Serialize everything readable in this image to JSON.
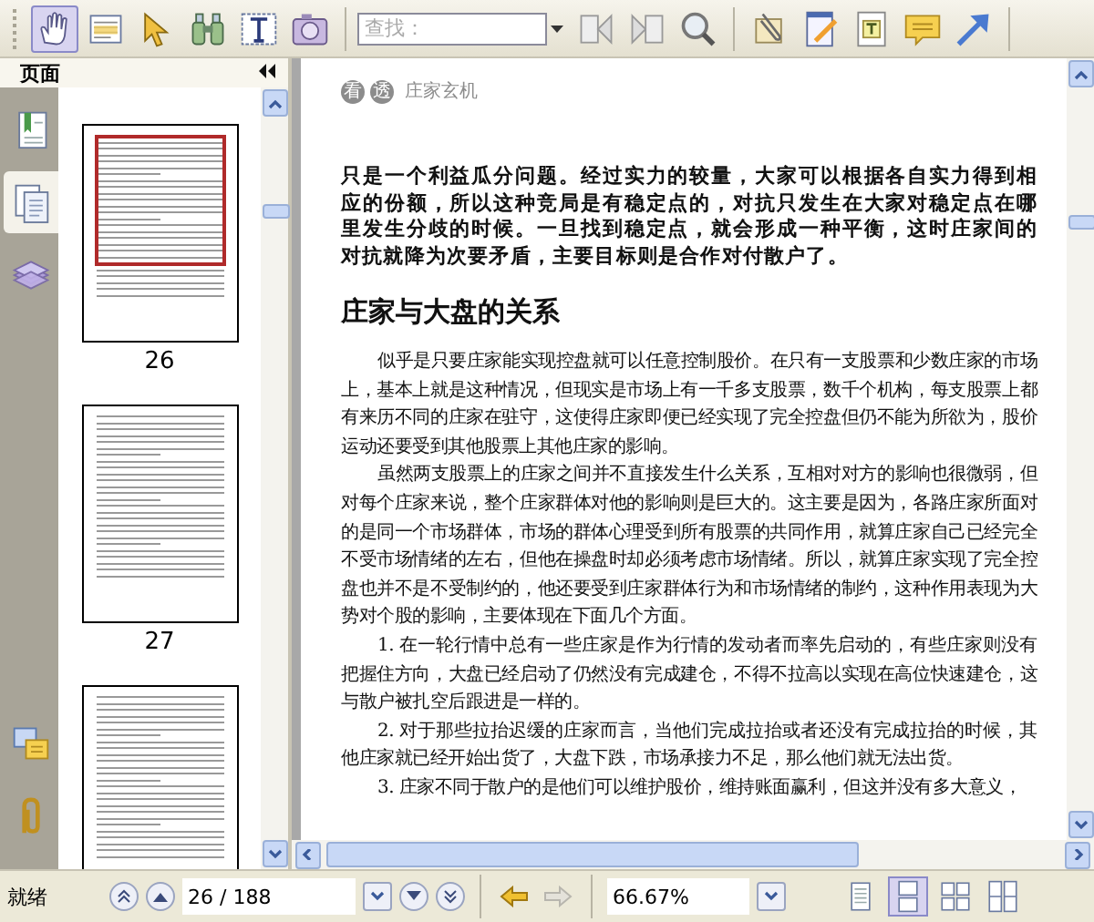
{
  "toolbar": {
    "tools": [
      {
        "kind": "hand",
        "selected": true
      },
      {
        "kind": "select",
        "selected": false
      },
      {
        "kind": "pointer",
        "selected": false
      },
      {
        "kind": "binoculars",
        "selected": false
      },
      {
        "kind": "text",
        "selected": false
      },
      {
        "kind": "camera",
        "selected": false
      }
    ],
    "search": {
      "placeholder": "查找："
    },
    "search_tools": [
      {
        "kind": "find-previous"
      },
      {
        "kind": "find-next"
      },
      {
        "kind": "search"
      }
    ],
    "comment_tools": [
      {
        "kind": "clip"
      },
      {
        "kind": "note-pad"
      },
      {
        "kind": "text-box"
      },
      {
        "kind": "comment"
      },
      {
        "kind": "arrow"
      }
    ]
  },
  "sidebar": {
    "title": "页面",
    "tabs": [
      {
        "kind": "bookmarks",
        "selected": false
      },
      {
        "kind": "pages",
        "selected": true
      },
      {
        "kind": "layers",
        "selected": false
      }
    ],
    "bottom_tabs": [
      {
        "kind": "comments"
      },
      {
        "kind": "attachments"
      }
    ],
    "thumbnails": [
      {
        "label": "26",
        "selected": true
      },
      {
        "label": "27",
        "selected": false
      },
      {
        "selected": false
      }
    ]
  },
  "document": {
    "running_header": {
      "marks": [
        "看",
        "透"
      ],
      "title": "庄家玄机"
    },
    "paragraphs": [
      {
        "kind": "lead",
        "text": "只是一个利益瓜分问题。经过实力的较量，大家可以根据各自实力得到相应的份额，所以这种竞局是有稳定点的，对抗只发生在大家对稳定点在哪里发生分歧的时候。一旦找到稳定点，就会形成一种平衡，这时庄家间的对抗就降为次要矛盾，主要目标则是合作对付散户了。"
      },
      {
        "kind": "heading",
        "text": "庄家与大盘的关系"
      },
      {
        "kind": "body",
        "text": "似乎是只要庄家能实现控盘就可以任意控制股价。在只有一支股票和少数庄家的市场上，基本上就是这种情况，但现实是市场上有一千多支股票，数千个机构，每支股票上都有来历不同的庄家在驻守，这使得庄家即便已经实现了完全控盘但仍不能为所欲为，股价运动还要受到其他股票上其他庄家的影响。"
      },
      {
        "kind": "body",
        "text": "虽然两支股票上的庄家之间并不直接发生什么关系，互相对对方的影响也很微弱，但对每个庄家来说，整个庄家群体对他的影响则是巨大的。这主要是因为，各路庄家所面对的是同一个市场群体，市场的群体心理受到所有股票的共同作用，就算庄家自己已经完全不受市场情绪的左右，但他在操盘时却必须考虑市场情绪。所以，就算庄家实现了完全控盘也并不是不受制约的，他还要受到庄家群体行为和市场情绪的制约，这种作用表现为大势对个股的影响，主要体现在下面几个方面。"
      },
      {
        "kind": "body",
        "text": "1. 在一轮行情中总有一些庄家是作为行情的发动者而率先启动的，有些庄家则没有把握住方向，大盘已经启动了仍然没有完成建仓，不得不拉高以实现在高位快速建仓，这与散户被扎空后跟进是一样的。"
      },
      {
        "kind": "body",
        "text": "2. 对于那些拉抬迟缓的庄家而言，当他们完成拉抬或者还没有完成拉抬的时候，其他庄家就已经开始出货了，大盘下跌，市场承接力不足，那么他们就无法出货。"
      },
      {
        "kind": "body",
        "text": "3. 庄家不同于散户的是他们可以维护股价，维持账面赢利，但这并没有多大意义，"
      }
    ]
  },
  "status_bar": {
    "status": "就绪",
    "page_field": {
      "value": "26 / 188"
    },
    "history": [
      {
        "kind": "back",
        "disabled": false
      },
      {
        "kind": "forward",
        "disabled": true
      }
    ],
    "zoom_field": {
      "value": "66.67%"
    },
    "view_modes": [
      {
        "kind": "single",
        "selected": false
      },
      {
        "kind": "continuous",
        "selected": true
      },
      {
        "kind": "facing",
        "selected": false
      },
      {
        "kind": "continuous-facing",
        "selected": false
      }
    ]
  }
}
